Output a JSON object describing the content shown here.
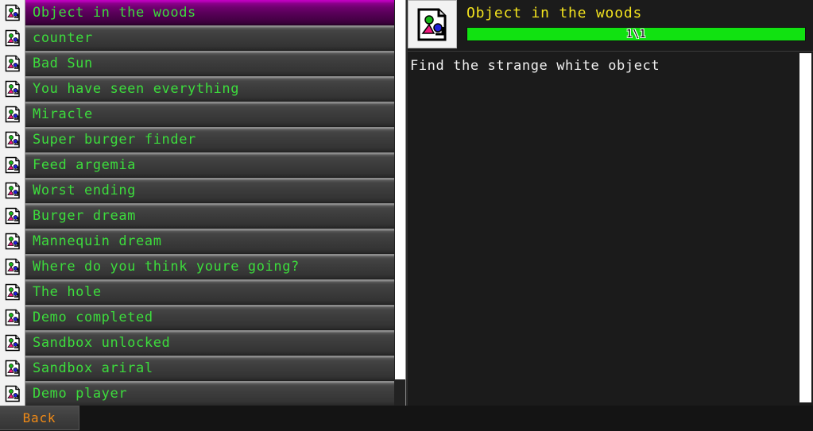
{
  "left_list": {
    "name": "achievement-list",
    "items": [
      {
        "label": "Object in the woods",
        "icon": "image-document-icon",
        "selected": true
      },
      {
        "label": "counter",
        "icon": "image-document-icon",
        "selected": false
      },
      {
        "label": "Bad Sun",
        "icon": "image-document-icon",
        "selected": false
      },
      {
        "label": "You have seen everything",
        "icon": "image-document-icon",
        "selected": false
      },
      {
        "label": "Miracle",
        "icon": "image-document-icon",
        "selected": false
      },
      {
        "label": "Super burger finder",
        "icon": "image-document-icon",
        "selected": false
      },
      {
        "label": "Feed argemia",
        "icon": "image-document-icon",
        "selected": false
      },
      {
        "label": "Worst ending",
        "icon": "image-document-icon",
        "selected": false
      },
      {
        "label": "Burger dream",
        "icon": "image-document-icon",
        "selected": false
      },
      {
        "label": "Mannequin dream",
        "icon": "image-document-icon",
        "selected": false
      },
      {
        "label": "Where do you think youre going?",
        "icon": "image-document-icon",
        "selected": false
      },
      {
        "label": "The hole",
        "icon": "image-document-icon",
        "selected": false
      },
      {
        "label": "Demo completed",
        "icon": "image-document-icon",
        "selected": false
      },
      {
        "label": "Sandbox unlocked",
        "icon": "image-document-icon",
        "selected": false
      },
      {
        "label": "Sandbox ariral",
        "icon": "image-document-icon",
        "selected": false
      },
      {
        "label": "Demo player",
        "icon": "image-document-icon",
        "selected": false
      }
    ]
  },
  "detail": {
    "icon": "image-document-icon",
    "title": "Object in the woods",
    "progress_text": "1\\1",
    "progress_percent": 100,
    "description": "Find the strange white object"
  },
  "bottom_bar": {
    "back_label": "Back"
  },
  "colors": {
    "list_text": "#3cdc3c",
    "selected_row": "#8e008e",
    "detail_title": "#f2e21e",
    "progress_fill": "#11e211",
    "description_text": "#f0f0f0",
    "back_label": "#f08a16",
    "scrollbar_thumb": "#ffffff"
  }
}
